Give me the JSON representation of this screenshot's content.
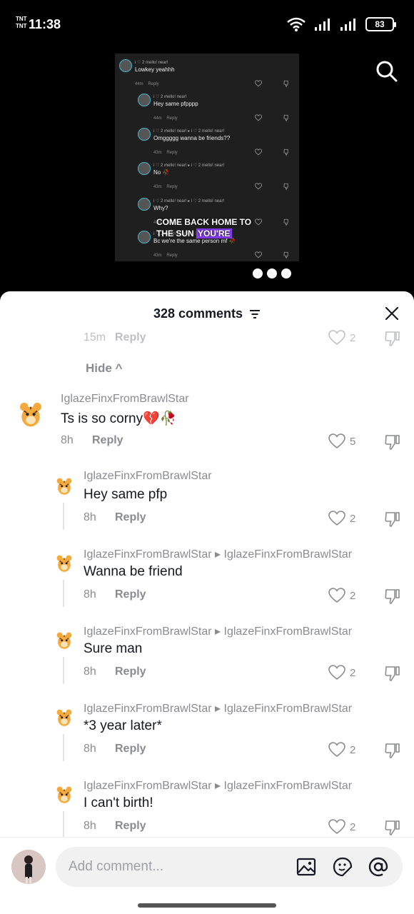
{
  "status_bar": {
    "carrier_top": "TNT",
    "carrier_bottom": "TNT",
    "time": "11:38",
    "battery": "83"
  },
  "video": {
    "caption_line1": "COME BACK HOME TO",
    "caption_line2a": "THE SUN",
    "caption_line2b": "YOU'RE",
    "rows": [
      {
        "user": "i ♡ 2 mello! near!",
        "text": "Lowkey yeahhh",
        "time": "44m",
        "reply": "Reply"
      },
      {
        "user": "i ♡ 2 mello! near!",
        "text": "Hey same pfpppp",
        "time": "44m",
        "reply": "Reply"
      },
      {
        "user": "i ♡ 2 mello! near! ▸ i ♡ 2 mello! near!",
        "text": "Omggggg wanna be friends??",
        "time": "43m",
        "reply": "Reply"
      },
      {
        "user": "i ♡ 2 mello! near! ▸ i ♡ 2 mello! near!",
        "text": "No 🥀",
        "time": "43m",
        "reply": "Reply"
      },
      {
        "user": "i ♡ 2 mello! near! ▸ i ♡ 2 mello! near!",
        "text": "Why?",
        "time": "43m",
        "reply": "Reply"
      },
      {
        "user": "i ♡ 2 mello! near! ▸ i ♡ 2 mello! near!",
        "text": "Bc we're the same person mf 🥀",
        "time": "43m",
        "reply": "Reply"
      }
    ]
  },
  "sheet": {
    "title": "328 comments",
    "hide_label": "Hide ^",
    "partial": {
      "time": "15m",
      "reply": "Reply",
      "likes": "2"
    },
    "comments": [
      {
        "user": "IglazeFinxFromBrawlStar",
        "text": "Ts is so corny💔🥀",
        "time": "8h",
        "reply": "Reply",
        "likes": "5"
      },
      {
        "user": "IglazeFinxFromBrawlStar",
        "text": "Hey same pfp",
        "time": "8h",
        "reply": "Reply",
        "likes": "2"
      },
      {
        "user": "IglazeFinxFromBrawlStar ▸ IglazeFinxFromBrawlStar",
        "text": "Wanna be friend",
        "time": "8h",
        "reply": "Reply",
        "likes": "2"
      },
      {
        "user": "IglazeFinxFromBrawlStar ▸ IglazeFinxFromBrawlStar",
        "text": "Sure man",
        "time": "8h",
        "reply": "Reply",
        "likes": "2"
      },
      {
        "user": "IglazeFinxFromBrawlStar ▸ IglazeFinxFromBrawlStar",
        "text": "*3 year later*",
        "time": "8h",
        "reply": "Reply",
        "likes": "2"
      },
      {
        "user": "IglazeFinxFromBrawlStar ▸ IglazeFinxFromBrawlStar",
        "text": "I can't birth!",
        "time": "8h",
        "reply": "Reply",
        "likes": "2"
      }
    ]
  },
  "input": {
    "placeholder": "Add comment..."
  },
  "colors": {
    "accent_highlight": "#8b3dff",
    "text_primary": "#161823",
    "text_secondary": "#8a8b91"
  }
}
